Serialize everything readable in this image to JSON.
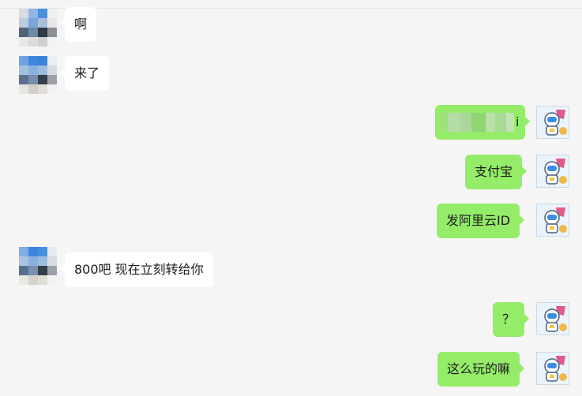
{
  "messages": [
    {
      "side": "left",
      "text": "啊"
    },
    {
      "side": "left",
      "text": "来了"
    },
    {
      "side": "right",
      "text": "i",
      "blurred": true
    },
    {
      "side": "right",
      "text": "支付宝"
    },
    {
      "side": "right",
      "text": "发阿里云ID"
    },
    {
      "side": "left",
      "text": "800吧 现在立刻转给你"
    },
    {
      "side": "right",
      "text": "？"
    },
    {
      "side": "right",
      "text": "这么玩的嘛"
    }
  ],
  "colors": {
    "background": "#f5f5f5",
    "bubble_self": "#95ec69",
    "bubble_other": "#ffffff"
  },
  "icons": {
    "contact_avatar": "pixelated-avatar-icon",
    "self_avatar": "astronaut-avatar-icon"
  }
}
